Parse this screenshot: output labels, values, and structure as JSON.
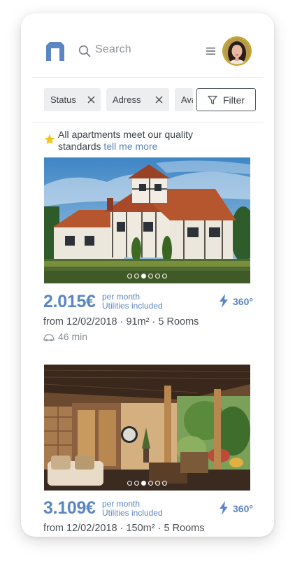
{
  "header": {
    "logo_icon": "building-logo-icon",
    "search_placeholder": "Search",
    "menu_icon": "hamburger-menu-icon",
    "avatar_icon": "user-avatar"
  },
  "filters": {
    "chips": [
      {
        "label": "Status"
      },
      {
        "label": "Adress"
      },
      {
        "label": "Availability"
      }
    ],
    "filter_button_label": "Filter"
  },
  "notice": {
    "text": "All apartments meet our quality standards",
    "link": "tell me more"
  },
  "listings": [
    {
      "price": "2.015€",
      "price_period": "per month",
      "price_note": "Utilities included",
      "badge": "360°",
      "details": "from 12/02/2018 · 91m² · 5 Rooms",
      "commute": "46 min",
      "slides": 6,
      "active_slide": 3
    },
    {
      "price": "3.109€",
      "price_period": "per month",
      "price_note": "Utilities included",
      "badge": "360°",
      "details": "from 12/02/2018 · 150m² · 5 Rooms",
      "slides": 6,
      "active_slide": 3
    }
  ],
  "colors": {
    "accent": "#5b86c4",
    "chip_bg": "#eceef0",
    "star": "#f5c518"
  }
}
